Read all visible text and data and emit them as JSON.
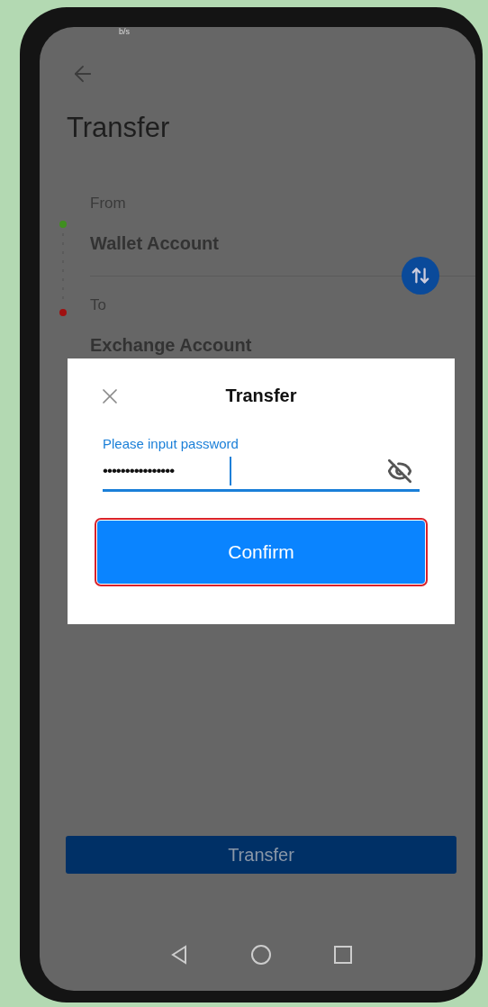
{
  "status_bar": {
    "text": "b/s"
  },
  "header": {
    "title": "Transfer"
  },
  "accounts": [
    {
      "label": "From",
      "name": "Wallet Account",
      "color": "#3f8f1f"
    },
    {
      "label": "To",
      "name": "Exchange Account",
      "color": "#a01010"
    }
  ],
  "primary_button": {
    "label": "Transfer"
  },
  "dialog": {
    "title": "Transfer",
    "password_field": {
      "label": "Please input password",
      "value": "••••••••••••••••",
      "focused": true,
      "visible": false
    },
    "confirm_button": {
      "label": "Confirm",
      "highlighted": true
    }
  }
}
